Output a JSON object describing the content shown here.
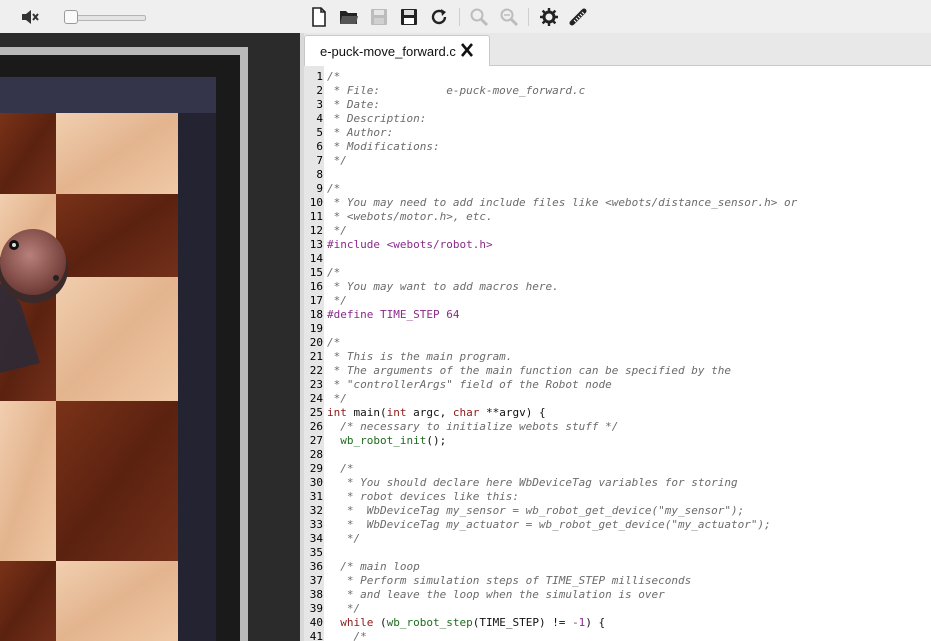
{
  "toolbar": {
    "icons": [
      "mute-icon",
      "new-file-icon",
      "open-folder-icon",
      "save-icon",
      "save-as-icon",
      "revert-icon",
      "find-icon",
      "replace-icon",
      "settings-icon",
      "compile-icon"
    ]
  },
  "volume": {
    "level": 0.0
  },
  "editor": {
    "tab": {
      "filename": "e-puck-move_forward.c"
    },
    "lines": [
      {
        "n": "1",
        "parts": [
          {
            "t": "/*",
            "c": "comment"
          }
        ]
      },
      {
        "n": "2",
        "parts": [
          {
            "t": " * File:          e-puck-move_forward.c",
            "c": "comment"
          }
        ]
      },
      {
        "n": "3",
        "parts": [
          {
            "t": " * Date:",
            "c": "comment"
          }
        ]
      },
      {
        "n": "4",
        "parts": [
          {
            "t": " * Description:",
            "c": "comment"
          }
        ]
      },
      {
        "n": "5",
        "parts": [
          {
            "t": " * Author:",
            "c": "comment"
          }
        ]
      },
      {
        "n": "6",
        "parts": [
          {
            "t": " * Modifications:",
            "c": "comment"
          }
        ]
      },
      {
        "n": "7",
        "parts": [
          {
            "t": " */",
            "c": "comment"
          }
        ]
      },
      {
        "n": "8",
        "parts": []
      },
      {
        "n": "9",
        "parts": [
          {
            "t": "/*",
            "c": "comment"
          }
        ]
      },
      {
        "n": "10",
        "parts": [
          {
            "t": " * You may need to add include files like <webots/distance_sensor.h> or",
            "c": "comment"
          }
        ]
      },
      {
        "n": "11",
        "parts": [
          {
            "t": " * <webots/motor.h>, etc.",
            "c": "comment"
          }
        ]
      },
      {
        "n": "12",
        "parts": [
          {
            "t": " */",
            "c": "comment"
          }
        ]
      },
      {
        "n": "13",
        "parts": [
          {
            "t": "#include <webots/robot.h>",
            "c": "pp"
          }
        ]
      },
      {
        "n": "14",
        "parts": []
      },
      {
        "n": "15",
        "parts": [
          {
            "t": "/*",
            "c": "comment"
          }
        ]
      },
      {
        "n": "16",
        "parts": [
          {
            "t": " * You may want to add macros here.",
            "c": "comment"
          }
        ]
      },
      {
        "n": "17",
        "parts": [
          {
            "t": " */",
            "c": "comment"
          }
        ]
      },
      {
        "n": "18",
        "parts": [
          {
            "t": "#define TIME_STEP 64",
            "c": "pp"
          }
        ]
      },
      {
        "n": "19",
        "parts": []
      },
      {
        "n": "20",
        "parts": [
          {
            "t": "/*",
            "c": "comment"
          }
        ]
      },
      {
        "n": "21",
        "parts": [
          {
            "t": " * This is the main program.",
            "c": "comment"
          }
        ]
      },
      {
        "n": "22",
        "parts": [
          {
            "t": " * The arguments of the main function can be specified by the",
            "c": "comment"
          }
        ]
      },
      {
        "n": "23",
        "parts": [
          {
            "t": " * \"controllerArgs\" field of the Robot node",
            "c": "comment"
          }
        ]
      },
      {
        "n": "24",
        "parts": [
          {
            "t": " */",
            "c": "comment"
          }
        ]
      },
      {
        "n": "25",
        "parts": [
          {
            "t": "int",
            "c": "kw"
          },
          {
            "t": " main(",
            "c": "plain"
          },
          {
            "t": "int",
            "c": "kw"
          },
          {
            "t": " argc, ",
            "c": "plain"
          },
          {
            "t": "char",
            "c": "kw"
          },
          {
            "t": " **argv) {",
            "c": "plain"
          }
        ]
      },
      {
        "n": "26",
        "parts": [
          {
            "t": "  /* necessary to initialize webots stuff */",
            "c": "comment"
          }
        ]
      },
      {
        "n": "27",
        "parts": [
          {
            "t": "  ",
            "c": "plain"
          },
          {
            "t": "wb_robot_init",
            "c": "fn"
          },
          {
            "t": "();",
            "c": "plain"
          }
        ]
      },
      {
        "n": "28",
        "parts": []
      },
      {
        "n": "29",
        "parts": [
          {
            "t": "  /*",
            "c": "comment"
          }
        ]
      },
      {
        "n": "30",
        "parts": [
          {
            "t": "   * You should declare here WbDeviceTag variables for storing",
            "c": "comment"
          }
        ]
      },
      {
        "n": "31",
        "parts": [
          {
            "t": "   * robot devices like this:",
            "c": "comment"
          }
        ]
      },
      {
        "n": "32",
        "parts": [
          {
            "t": "   *  WbDeviceTag my_sensor = wb_robot_get_device(\"my_sensor\");",
            "c": "comment"
          }
        ]
      },
      {
        "n": "33",
        "parts": [
          {
            "t": "   *  WbDeviceTag my_actuator = wb_robot_get_device(\"my_actuator\");",
            "c": "comment"
          }
        ]
      },
      {
        "n": "34",
        "parts": [
          {
            "t": "   */",
            "c": "comment"
          }
        ]
      },
      {
        "n": "35",
        "parts": []
      },
      {
        "n": "36",
        "parts": [
          {
            "t": "  /* main loop",
            "c": "comment"
          }
        ]
      },
      {
        "n": "37",
        "parts": [
          {
            "t": "   * Perform simulation steps of TIME_STEP milliseconds",
            "c": "comment"
          }
        ]
      },
      {
        "n": "38",
        "parts": [
          {
            "t": "   * and leave the loop when the simulation is over",
            "c": "comment"
          }
        ]
      },
      {
        "n": "39",
        "parts": [
          {
            "t": "   */",
            "c": "comment"
          }
        ]
      },
      {
        "n": "40",
        "parts": [
          {
            "t": "  ",
            "c": "plain"
          },
          {
            "t": "while",
            "c": "kw"
          },
          {
            "t": " (",
            "c": "plain"
          },
          {
            "t": "wb_robot_step",
            "c": "fn"
          },
          {
            "t": "(TIME_STEP) != ",
            "c": "plain"
          },
          {
            "t": "-1",
            "c": "num"
          },
          {
            "t": ") {",
            "c": "plain"
          }
        ]
      },
      {
        "n": "41",
        "parts": [
          {
            "t": "    /*",
            "c": "comment"
          }
        ]
      }
    ]
  }
}
